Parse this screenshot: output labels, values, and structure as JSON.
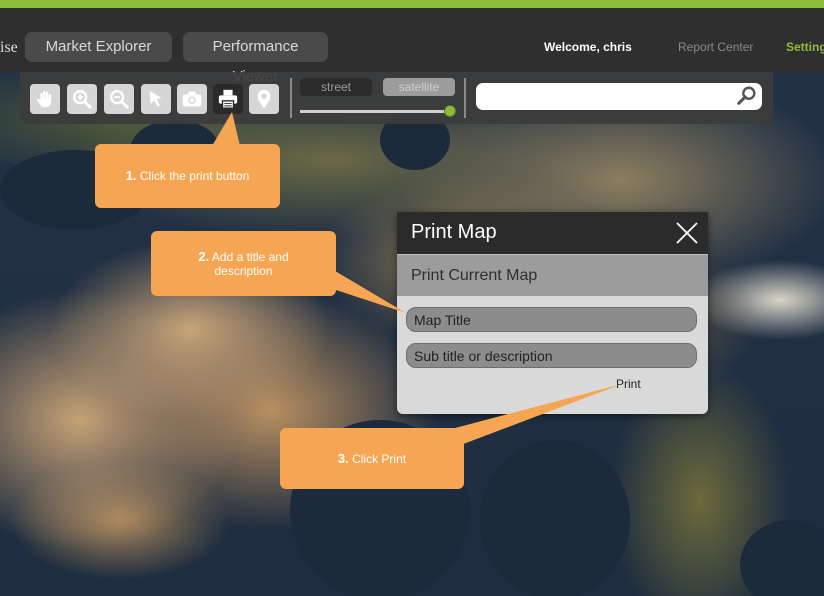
{
  "header": {
    "brand_fragment": "ise",
    "nav": [
      {
        "label": "Market Explorer"
      },
      {
        "label": "Performance Viewer"
      }
    ],
    "welcome": "Welcome, chris",
    "report_center": "Report Center",
    "settings": "Settings",
    "accent_color": "#8cbc3c"
  },
  "toolbar": {
    "tools": [
      {
        "icon": "pan-hand-icon"
      },
      {
        "icon": "zoom-in-icon"
      },
      {
        "icon": "zoom-out-icon"
      },
      {
        "icon": "select-arrow-icon"
      },
      {
        "icon": "camera-icon"
      },
      {
        "icon": "printer-icon",
        "active": true
      },
      {
        "icon": "map-pin-icon"
      }
    ],
    "map_types": {
      "street": "street",
      "satellite": "satellite",
      "selected": "satellite"
    },
    "layer_opacity": 1.0,
    "search": {
      "value": "",
      "placeholder": ""
    }
  },
  "callouts": {
    "step1_number": "1.",
    "step1_text": "Click the print button",
    "step2_number": "2.",
    "step2_text": "Add a title and description",
    "step3_number": "3.",
    "step3_text": "Click Print",
    "color": "#f6a552"
  },
  "print_dialog": {
    "title": "Print Map",
    "subtitle": "Print Current Map",
    "title_field_placeholder": "Map Title",
    "subtitle_field_placeholder": "Sub title or description",
    "print_label": "Print"
  }
}
